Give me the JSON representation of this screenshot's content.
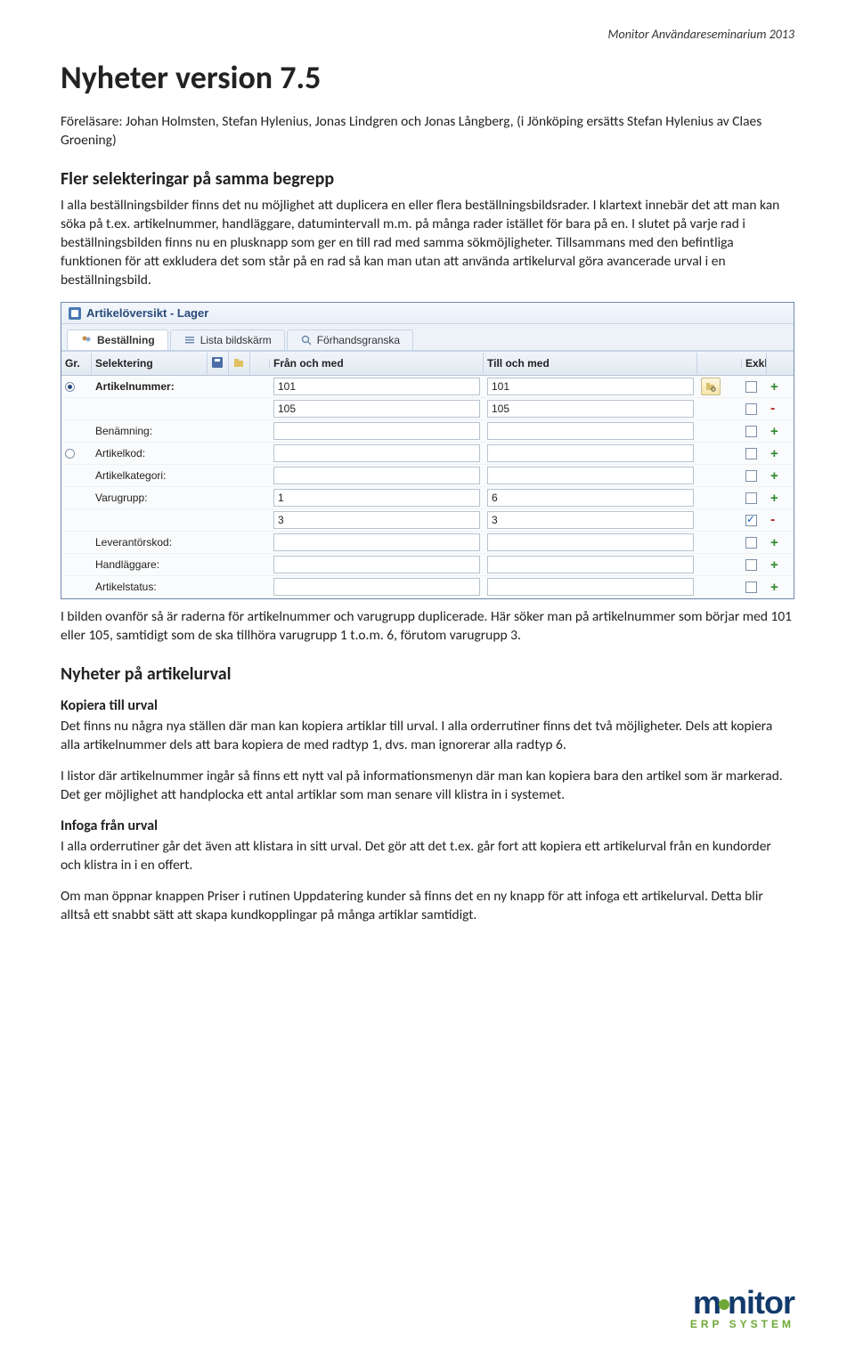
{
  "header_right": "Monitor Användareseminarium 2013",
  "title": "Nyheter version 7.5",
  "lecturers": "Föreläsare: Johan Holmsten, Stefan Hylenius, Jonas Lindgren och Jonas Långberg, (i Jönköping ersätts Stefan Hylenius av Claes Groening)",
  "section1_heading": "Fler selekteringar på samma begrepp",
  "section1_body": "I alla beställningsbilder finns det nu möjlighet att duplicera en eller flera beställningsbildsrader. I klartext innebär det att man kan söka på t.ex. artikelnummer, handläggare, datumintervall m.m. på många rader istället för bara på en. I slutet på varje rad i beställningsbilden finns nu en plusknapp som ger en till rad med samma sökmöjligheter. Tillsammans med den befintliga funktionen för att exkludera det som står på en rad så kan man utan att använda artikelurval göra avancerade urval i en beställningsbild.",
  "app": {
    "title": "Artikelöversikt - Lager",
    "tabs": {
      "bestallning": "Beställning",
      "lista": "Lista bildskärm",
      "forhand": "Förhandsgranska"
    },
    "headers": {
      "gr": "Gr.",
      "selektering": "Selektering",
      "fran": "Från och med",
      "till": "Till och med",
      "exkl": "Exkl."
    },
    "rows": [
      {
        "label": "Artikelnummer:",
        "bold": true,
        "radio": "checked",
        "from": "101",
        "to": "101",
        "search": true,
        "chk": false,
        "action": "+"
      },
      {
        "label": "",
        "bold": false,
        "radio": "",
        "from": "105",
        "to": "105",
        "search": false,
        "chk": false,
        "action": "-"
      },
      {
        "label": "Benämning:",
        "bold": false,
        "radio": "",
        "from": "",
        "to": "",
        "search": false,
        "chk": false,
        "action": "+"
      },
      {
        "label": "Artikelkod:",
        "bold": false,
        "radio": "unchecked",
        "from": "",
        "to": "",
        "search": false,
        "chk": false,
        "action": "+"
      },
      {
        "label": "Artikelkategori:",
        "bold": false,
        "radio": "",
        "from": "",
        "to": "",
        "search": false,
        "chk": false,
        "action": "+"
      },
      {
        "label": "Varugrupp:",
        "bold": false,
        "radio": "",
        "from": "1",
        "to": "6",
        "search": false,
        "chk": false,
        "action": "+"
      },
      {
        "label": "",
        "bold": false,
        "radio": "",
        "from": "3",
        "to": "3",
        "search": false,
        "chk": true,
        "action": "-"
      },
      {
        "label": "Leverantörskod:",
        "bold": false,
        "radio": "",
        "from": "",
        "to": "",
        "search": false,
        "chk": false,
        "action": "+"
      },
      {
        "label": "Handläggare:",
        "bold": false,
        "radio": "",
        "from": "",
        "to": "",
        "search": false,
        "chk": false,
        "action": "+"
      },
      {
        "label": "Artikelstatus:",
        "bold": false,
        "radio": "",
        "from": "",
        "to": "",
        "search": false,
        "chk": false,
        "action": "+"
      }
    ]
  },
  "caption_after_app": "I bilden ovanför så är raderna för artikelnummer och varugrupp duplicerade. Här söker man på artikelnummer som börjar med 101 eller 105, samtidigt som de ska tillhöra varugrupp 1 t.o.m. 6, förutom varugrupp 3.",
  "section2_heading": "Nyheter på artikelurval",
  "sub_kopiera_heading": "Kopiera till urval",
  "sub_kopiera_p1": "Det finns nu några nya ställen där man kan kopiera artiklar till urval. I alla orderrutiner finns det två möjligheter. Dels att kopiera alla artikelnummer dels att bara kopiera de med radtyp 1, dvs. man ignorerar alla radtyp 6.",
  "sub_kopiera_p2": "I listor där artikelnummer ingår så finns ett nytt val på informationsmenyn där man kan kopiera bara den artikel som är markerad. Det ger möjlighet att handplocka ett antal artiklar som man senare vill klistra in i systemet.",
  "sub_infoga_heading": "Infoga från urval",
  "sub_infoga_p1": "I alla orderrutiner går det även att klistara in sitt urval. Det gör att det t.ex. går fort att kopiera ett artikelurval från en kundorder och klistra in i en offert.",
  "sub_infoga_p2": "Om man öppnar knappen Priser i rutinen Uppdatering kunder så finns det en ny knapp för att infoga ett artikelurval. Detta blir alltså ett snabbt sätt att skapa kundkopplingar på många artiklar samtidigt.",
  "footer": {
    "brand": "monitor",
    "tagline": "ERP SYSTEM"
  }
}
